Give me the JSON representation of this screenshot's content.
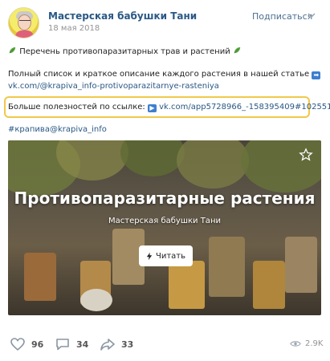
{
  "post": {
    "author": "Мастерская бабушки Тани",
    "date": "18 мая 2018",
    "subscribe_label": "Подписаться",
    "line1": "Перечень противопаразитарных трав и растений",
    "line2": "Полный список и краткое описание каждого растения в нашей статье",
    "line2_link": "vk.com/@krapiva_info-protivoparazitarnye-rasteniya",
    "line4_text": "Больше полезностей по ссылке:",
    "line4_link": "vk.com/app5728966_-158395409#102551",
    "hashtag": "#крапива@krapiva_info"
  },
  "card": {
    "title": "Противопаразитарные растения",
    "subtitle": "Мастерская бабушки Тани",
    "read_label": "Читать"
  },
  "footer": {
    "likes": "96",
    "comments": "34",
    "shares": "33",
    "views": "2.9K"
  },
  "colors": {
    "link": "#2a5885",
    "highlight": "#f0c84a",
    "background": "#ffffff"
  },
  "icons": [
    "avatar",
    "chevron-down-icon",
    "herb-emoji-icon",
    "arrow-right-icon",
    "play-arrow-icon",
    "star-icon",
    "lightning-icon",
    "heart-icon",
    "comment-icon",
    "share-icon",
    "eye-icon"
  ]
}
